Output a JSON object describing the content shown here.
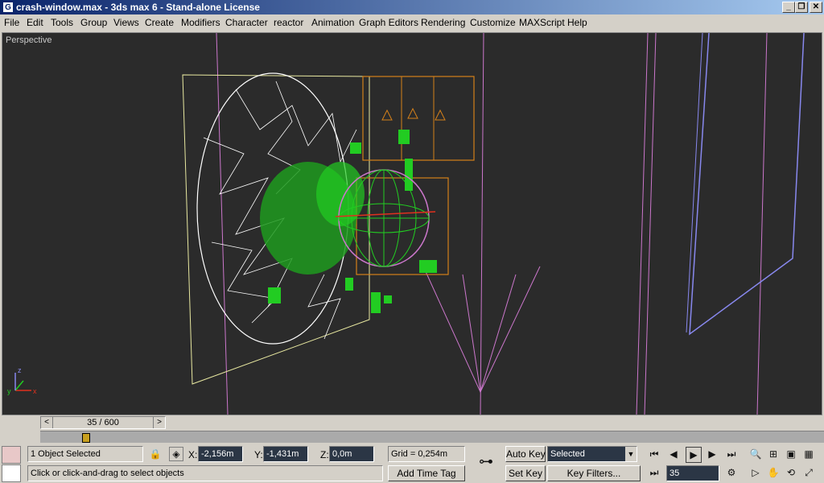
{
  "window": {
    "title": "crash-window.max - 3ds max 6 - Stand-alone License",
    "app_icon_glyph": "G",
    "minimize_glyph": "_",
    "maximize_glyph": "❐",
    "close_glyph": "✕"
  },
  "menu": {
    "items": [
      "File",
      "Edit",
      "Tools",
      "Group",
      "Views",
      "Create",
      "Modifiers",
      "Character",
      "reactor",
      "Animation",
      "Graph Editors",
      "Rendering",
      "Customize",
      "MAXScript",
      "Help"
    ]
  },
  "viewport": {
    "label": "Perspective",
    "axis_labels": {
      "x": "x",
      "y": "y",
      "z": "z"
    }
  },
  "timeline": {
    "frame_display": "35 / 600",
    "prev_glyph": "<",
    "next_glyph": ">"
  },
  "status": {
    "selection": "1 Object Selected",
    "prompt": "Click or click-and-drag to select objects",
    "x_label": "X:",
    "x_value": "-2,156m",
    "y_label": "Y:",
    "y_value": "-1,431m",
    "z_label": "Z:",
    "z_value": "0,0m",
    "grid": "Grid = 0,254m",
    "add_time_tag": "Add Time Tag",
    "auto_key": "Auto Key",
    "set_key": "Set Key",
    "key_filter_select": "Selected",
    "key_filters": "Key Filters...",
    "current_frame": "35"
  },
  "colors": {
    "viewport_bg": "#2b2b2b",
    "wire_white": "#ffffff",
    "wire_green": "#22cc22",
    "wire_orange": "#d4801a",
    "wire_yellow": "#e8e8a0",
    "wire_pink": "#cc77cc",
    "wire_blue": "#8888ee",
    "selection_red": "#e0301e"
  }
}
